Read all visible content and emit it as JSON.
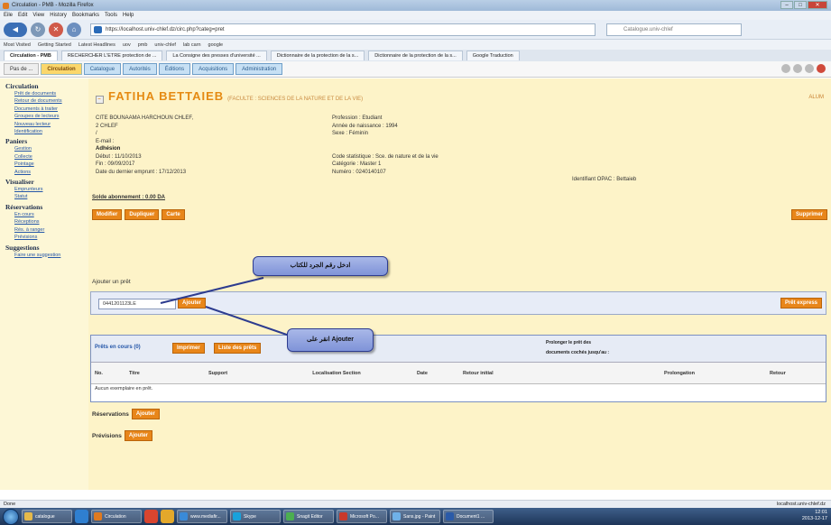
{
  "window": {
    "title": "Circulation - PMB - Mozilla Firefox"
  },
  "menu": [
    "Eile",
    "Edit",
    "View",
    "History",
    "Bookmarks",
    "Tools",
    "Help"
  ],
  "nav": {
    "url": "https://localhost.univ-chlef.dz/circ.php?categ=pret",
    "search_placeholder": "Catalogue.univ-chlef"
  },
  "bookmarks": [
    "Most Visited",
    "Getting Started",
    "Latest Headlines",
    "uov",
    "pmb",
    "univ-chlef",
    "lab carn",
    "google"
  ],
  "tabs": [
    {
      "label": "Circulation - PMB",
      "active": true
    },
    {
      "label": "RECHERCHER L'ETRE protection de ...",
      "active": false
    },
    {
      "label": "La Consigne des presses d'université ...",
      "active": false
    },
    {
      "label": "Dictionnaire de la protection de la s...",
      "active": false
    },
    {
      "label": "Dictionnaire de la protection de la s...",
      "active": false
    },
    {
      "label": "Google Traduction",
      "active": false
    }
  ],
  "pmb_tabs": [
    {
      "label": "Pas de ...",
      "style": "plain"
    },
    {
      "label": "Circulation",
      "style": "active"
    },
    {
      "label": "Catalogue",
      "style": "blue"
    },
    {
      "label": "Autorités",
      "style": "blue"
    },
    {
      "label": "Éditions",
      "style": "blue"
    },
    {
      "label": "Acquisitions",
      "style": "blue"
    },
    {
      "label": "Administration",
      "style": "blue"
    }
  ],
  "sidebar": [
    {
      "head": "Circulation",
      "items": [
        "Prêt de documents",
        "Retour de documents",
        "Documents à traiter",
        "Groupes de lecteurs",
        "Nouveau lecteur",
        "Identification"
      ]
    },
    {
      "head": "Paniers",
      "items": [
        "Gestion",
        "Collecte",
        "Pointage",
        "Actions"
      ]
    },
    {
      "head": "Visualiser",
      "items": [
        "Emprunteurs",
        "Statut"
      ]
    },
    {
      "head": "Réservations",
      "items": [
        "En cours",
        "Réceptions",
        "Rés. à ranger",
        "Prévisions"
      ]
    },
    {
      "head": "Suggestions",
      "items": [
        "Faire une suggestion"
      ]
    }
  ],
  "reader": {
    "name": "FATIHA BETTAIEB",
    "sub": "(FACULTE : SCIENCES DE LA NATURE ET DE LA VIE)",
    "auth": "ALUM",
    "address_lines": [
      "CITE BOUNAAMA HARCHOUN CHLEF,",
      "2 CHLEF",
      "/",
      "E-mail :"
    ],
    "adhesion_label": "Adhésion",
    "debut": "Début : 11/10/2013",
    "fin": "Fin : 09/09/2017",
    "dernier_emprunt": "Date du dernier emprunt : 17/12/2013",
    "profession": "Profession : Etudiant",
    "annee_naissance": "Année de naissance : 1994",
    "sexe": "Sexe : Féminin",
    "code_stat": "Code statistique : Sce. de nature et de la vie",
    "categorie": "Catégorie : Master 1",
    "numero": "Numéro : 0240140107",
    "opac": "Identifiant OPAC : Bettaieb",
    "solde": "Solde abonnement : 0.00 DA"
  },
  "buttons": {
    "modifier": "Modifier",
    "dupliquer": "Dupliquer",
    "carte": "Carte",
    "supprimer": "Supprimer",
    "ajouter": "Ajouter",
    "pret_express": "Prêt express",
    "imprimer": "Imprimer",
    "liste_prets": "Liste des prêts"
  },
  "pret": {
    "label": "Ajouter un prêt",
    "code_value": "0441201123LE"
  },
  "loans": {
    "title": "Prêts en cours (0)",
    "prolonger": "Prolonger le prêt des",
    "prolonger2": "documents cochés jusqu'au :",
    "columns": [
      "No.",
      "Titre",
      "Support",
      "Localisation Section",
      "Date",
      "Retour initial",
      "Prolongation",
      "Retour"
    ],
    "empty": "Aucun exemplaire en prêt."
  },
  "reservations": {
    "label": "Réservations"
  },
  "previsions": {
    "label": "Prévisions"
  },
  "callouts": {
    "top": "ادخل رقم الجرد للكتاب",
    "bottom": "انقر على Ajouter"
  },
  "status": {
    "left": "Done",
    "right": "localhost.univ-chlef.dz"
  },
  "taskbar": {
    "items": [
      "catalogue",
      "Circulation",
      "",
      "",
      "www.mediafir...",
      "Skype",
      "Snagit Editor",
      "Microsoft Po...",
      "Sans.jpg - Paint",
      "Document1 ..."
    ],
    "time": "12:01",
    "date": "2013-12-17"
  },
  "colors": {
    "accent_orange": "#e8861a",
    "main_bg": "#fdf3c8",
    "sidebar_bg": "#fdf7d6"
  }
}
